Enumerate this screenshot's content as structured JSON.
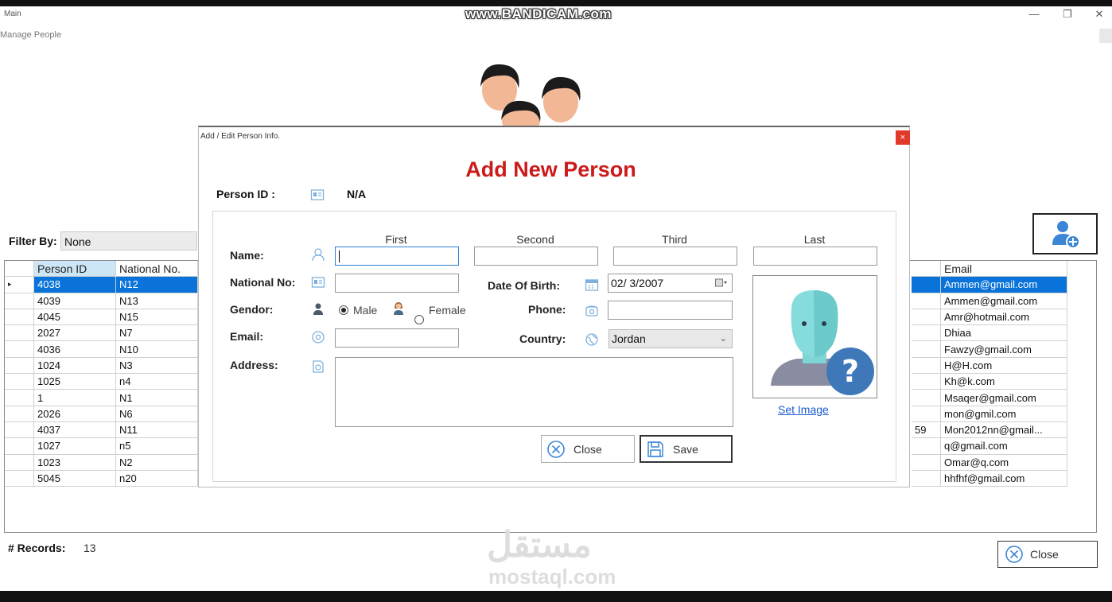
{
  "window": {
    "title": "Main",
    "subtitle": "Manage People",
    "watermark_recorder": "www.BANDICAM.com"
  },
  "filter": {
    "label": "Filter By:",
    "value": "None"
  },
  "left_grid": {
    "columns": [
      "Person ID",
      "National No."
    ],
    "rows": [
      [
        "4038",
        "N12"
      ],
      [
        "4039",
        "N13"
      ],
      [
        "4045",
        "N15"
      ],
      [
        "2027",
        "N7"
      ],
      [
        "4036",
        "N10"
      ],
      [
        "1024",
        "N3"
      ],
      [
        "1025",
        "n4"
      ],
      [
        "1",
        "N1"
      ],
      [
        "2026",
        "N6"
      ],
      [
        "4037",
        "N11"
      ],
      [
        "1027",
        "n5"
      ],
      [
        "1023",
        "N2"
      ],
      [
        "5045",
        "n20"
      ]
    ],
    "selected_row": 0
  },
  "right_grid": {
    "columns": [
      "",
      "Email"
    ],
    "rows": [
      [
        "",
        "Ammen@gmail.com"
      ],
      [
        "",
        "Ammen@gmail.com"
      ],
      [
        "",
        "Amr@hotmail.com"
      ],
      [
        "",
        "Dhiaa"
      ],
      [
        "",
        "Fawzy@gmail.com"
      ],
      [
        "",
        "H@H.com"
      ],
      [
        "",
        "Kh@k.com"
      ],
      [
        "",
        "Msaqer@gmail.com"
      ],
      [
        "",
        "mon@gmil.com"
      ],
      [
        "59",
        "Mon2012nn@gmail..."
      ],
      [
        "",
        "q@gmail.com"
      ],
      [
        "",
        "Omar@q.com"
      ],
      [
        "",
        "hhfhf@gmail.com"
      ]
    ]
  },
  "records": {
    "label": "# Records:",
    "count": "13"
  },
  "main_close_label": "Close",
  "watermark": {
    "arabic": "مستقل",
    "latin": "mostaql.com"
  },
  "dialog": {
    "title": "Add / Edit Person Info.",
    "close_x": "×",
    "heading": "Add New Person",
    "person_id_label": "Person ID :",
    "person_id_value": "N/A",
    "name_columns": {
      "first": "First",
      "second": "Second",
      "third": "Third",
      "last": "Last"
    },
    "labels": {
      "name": "Name:",
      "national_no": "National No:",
      "gender": "Gendor:",
      "email": "Email:",
      "address": "Address:",
      "dob": "Date Of Birth:",
      "phone": "Phone:",
      "country": "Country:"
    },
    "gender_options": {
      "male": "Male",
      "female": "Female",
      "selected": "male"
    },
    "dob_value": "02/  3/2007",
    "country_value": "Jordan",
    "set_image_label": "Set Image",
    "close_label": "Close",
    "save_label": "Save"
  },
  "colors": {
    "accent": "#0a73d9",
    "heading": "#cc1a1a",
    "link": "#1a5bd1"
  }
}
